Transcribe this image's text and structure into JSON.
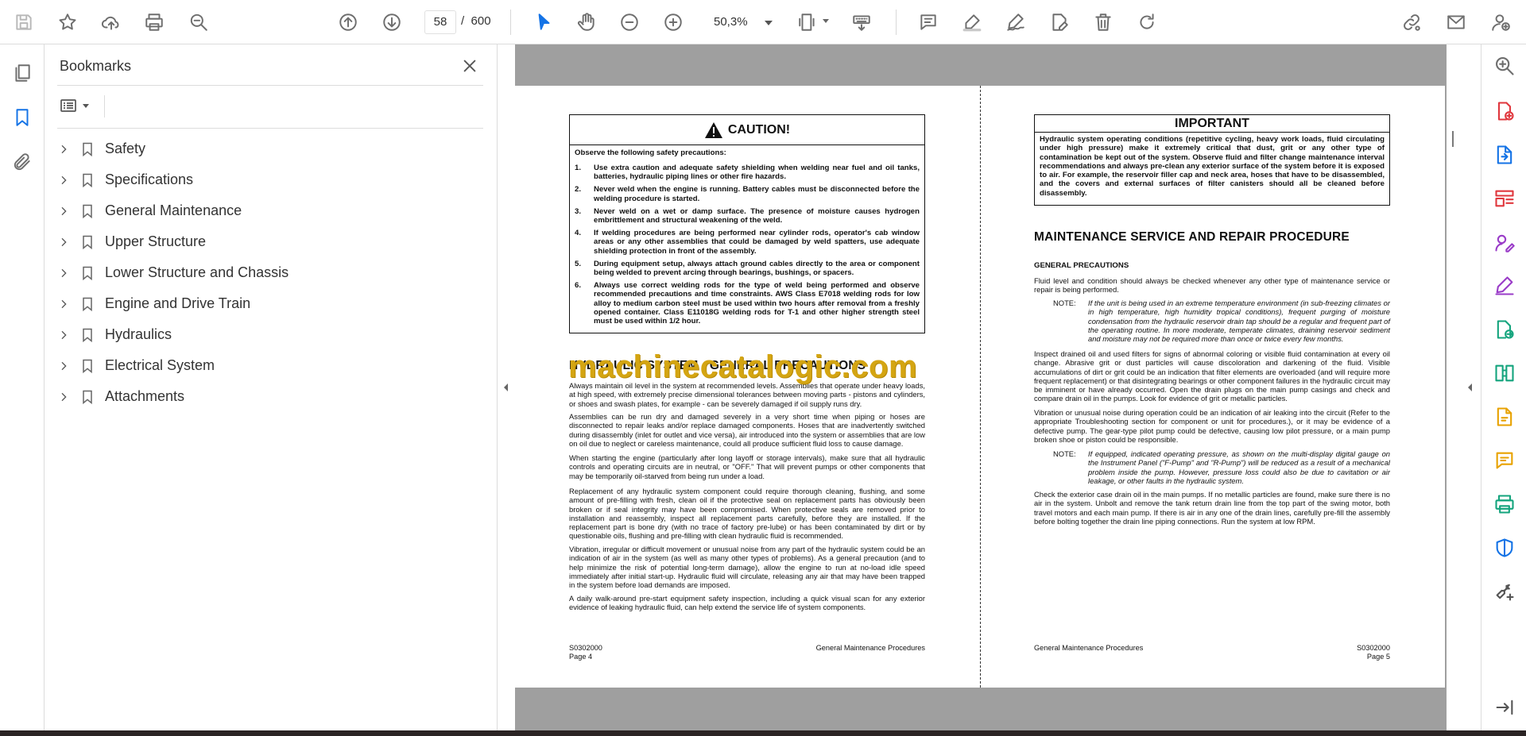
{
  "toolbar": {
    "current_page": "58",
    "page_separator": "/",
    "total_pages": "600",
    "zoom": "50,3%"
  },
  "bookmarks": {
    "title": "Bookmarks",
    "items": [
      {
        "label": "Safety"
      },
      {
        "label": "Specifications"
      },
      {
        "label": "General Maintenance"
      },
      {
        "label": "Upper Structure"
      },
      {
        "label": "Lower Structure and Chassis"
      },
      {
        "label": "Engine and Drive Train"
      },
      {
        "label": "Hydraulics"
      },
      {
        "label": "Electrical System"
      },
      {
        "label": "Attachments"
      }
    ]
  },
  "left_page": {
    "caution_title": "CAUTION!",
    "caution_intro": "Observe the following safety precautions:",
    "caution_items": [
      {
        "num": "1.",
        "text": "Use extra caution and adequate safety shielding when welding near fuel and oil tanks, batteries, hydraulic piping lines or other fire hazards."
      },
      {
        "num": "2.",
        "text": "Never weld when the engine is running. Battery cables must be disconnected before the welding procedure is started."
      },
      {
        "num": "3.",
        "text": "Never weld on a wet or damp surface. The presence of moisture causes hydrogen embrittlement and structural weakening of the weld."
      },
      {
        "num": "4.",
        "text": "If welding procedures are being performed near cylinder rods, operator's cab window areas or any other assemblies that could be damaged by weld spatters, use adequate shielding protection in front of the assembly."
      },
      {
        "num": "5.",
        "text": "During equipment setup, always attach ground cables directly to the area or component being welded to prevent arcing through bearings, bushings, or spacers."
      },
      {
        "num": "6.",
        "text": "Always use correct welding rods for the type of weld being performed and observe recommended precautions and time constraints. AWS Class E7018 welding rods for low alloy to medium carbon steel must be used within two hours after removal from a freshly opened container. Class E11018G welding rods for T-1 and other higher strength steel must be used within 1/2 hour."
      }
    ],
    "section_heading": "HYDRAULIC SYSTEM - GENERAL PRECAUTIONS",
    "paragraphs": [
      "Always maintain oil level in the system at recommended levels. Assemblies that operate under heavy loads, at high speed, with extremely precise dimensional tolerances between moving parts - pistons and cylinders, or shoes and swash plates, for example - can be severely damaged if oil supply runs dry.",
      "Assemblies can be run dry and damaged severely in a very short time when piping or hoses are disconnected to repair leaks and/or replace damaged components. Hoses that are inadvertently switched during disassembly (inlet for outlet and vice versa), air introduced into the system or assemblies that are low on oil due to neglect or careless maintenance, could all produce sufficient fluid loss to cause damage.",
      "When starting the engine (particularly after long layoff or storage intervals), make sure that all hydraulic controls and operating circuits are in neutral, or \"OFF.\" That will prevent pumps or other components that may be temporarily oil-starved from being run under a load.",
      "Replacement of any hydraulic system component could require thorough cleaning, flushing, and some amount of pre-filling with fresh, clean oil if the protective seal on replacement parts has obviously been broken or if seal integrity may have been compromised. When protective seals are removed prior to installation and reassembly, inspect all replacement parts carefully, before they are installed. If the replacement part is bone dry (with no trace of factory pre-lube) or has been contaminated by dirt or by questionable oils, flushing and pre-filling with clean hydraulic fluid is recommended.",
      "Vibration, irregular or difficult movement or unusual noise from any part of the hydraulic system could be an indication of air in the system (as well as many other types of problems). As a general precaution (and to help minimize the risk of potential long-term damage), allow the engine to run at no-load idle speed immediately after initial start-up. Hydraulic fluid will circulate, releasing any air that may have been trapped in the system before load demands are imposed.",
      "A daily walk-around pre-start equipment safety inspection, including a quick visual scan for any exterior evidence of leaking hydraulic fluid, can help extend the service life of system components."
    ],
    "footer_code": "S0302000",
    "footer_page": "Page 4",
    "footer_title": "General Maintenance Procedures"
  },
  "right_page": {
    "important_title": "IMPORTANT",
    "important_text": "Hydraulic system operating conditions (repetitive cycling, heavy work loads, fluid circulating under high pressure) make it extremely critical that dust, grit or any other type of contamination be kept out of the system. Observe fluid and filter change maintenance interval recommendations and always pre-clean any exterior surface of the system before it is exposed to air. For example, the reservoir filler cap and neck area, hoses that have to be disassembled, and the covers and external surfaces of filter canisters should all be cleaned before disassembly.",
    "section_heading": "MAINTENANCE SERVICE AND REPAIR PROCEDURE",
    "sub_heading": "GENERAL PRECAUTIONS",
    "para1": "Fluid level and condition should always be checked whenever any other type of maintenance service or repair is being performed.",
    "note_label": "NOTE:",
    "note1": "If the unit is being used in an extreme temperature environment (in sub-freezing climates or in high temperature, high humidity tropical conditions), frequent purging of moisture condensation from the hydraulic reservoir drain tap should be a regular and frequent part of the operating routine. In more moderate, temperate climates, draining reservoir sediment and moisture may not be required more than once or twice every few months.",
    "para2": "Inspect drained oil and used filters for signs of abnormal coloring or visible fluid contamination at every oil change. Abrasive grit or dust particles will cause discoloration and darkening of the fluid. Visible accumulations of dirt or grit could be an indication that filter elements are overloaded (and will require more frequent replacement) or that disintegrating bearings or other component failures in the hydraulic circuit may be imminent or have already occurred. Open the drain plugs on the main pump casings and check and compare drain oil in the pumps. Look for evidence of grit or metallic particles.",
    "para3": "Vibration or unusual noise during operation could be an indication of air leaking into the circuit (Refer to the appropriate Troubleshooting section for component or unit for procedures.), or it may be evidence of a defective pump. The gear-type pilot pump could be defective, causing low pilot pressure, or a main pump broken shoe or piston could be responsible.",
    "note2": "If equipped, indicated operating pressure, as shown on the multi-display digital gauge on the Instrument Panel (\"F-Pump\" and \"R-Pump\") will be reduced as a result of a mechanical problem inside the pump. However, pressure loss could also be due to cavitation or air leakage, or other faults in the hydraulic system.",
    "para4": "Check the exterior case drain oil in the main pumps. If no metallic particles are found, make sure there is no air in the system. Unbolt and remove the tank return drain line from the top part of the swing motor, both travel motors and each main pump. If there is air in any one of the drain lines, carefully pre-fill the assembly before bolting together the drain line piping connections. Run the system at low RPM.",
    "footer_title": "General Maintenance Procedures",
    "footer_code": "S0302000",
    "footer_page": "Page 5"
  },
  "watermark": "machinecatalogic.com",
  "colors": {
    "accent_blue": "#1473e6",
    "page_gray": "#9f9f9f",
    "watermark": "#d4a512"
  }
}
